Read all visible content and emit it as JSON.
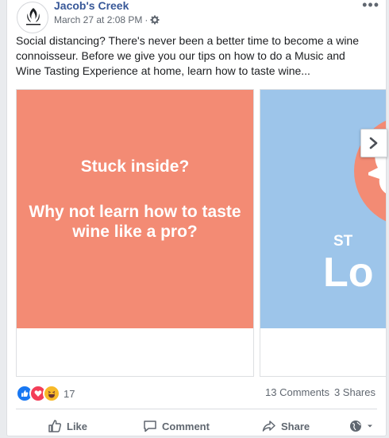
{
  "post": {
    "page_name": "Jacob's Creek",
    "timestamp": "March 27 at 2:08 PM",
    "separator": "·",
    "text": "Social distancing? There's never been a better time to become a wine connoisseur. Before we give you our tips on how to do a Music and Wine Tasting Experience at home, learn how to taste wine..."
  },
  "carousel": {
    "slide1": {
      "line1": "Stuck inside?",
      "line2": "Why not learn how to taste wine like a pro?"
    },
    "slide2": {
      "fragment_small": "ST",
      "fragment_large": "Lo"
    }
  },
  "engagement": {
    "reaction_count": "17",
    "comments": "13 Comments",
    "shares": "3 Shares"
  },
  "actions": {
    "like": "Like",
    "comment": "Comment",
    "share": "Share"
  },
  "colors": {
    "slide1_bg": "#f38b74",
    "slide2_bg": "#9dc5ea",
    "link": "#385898"
  }
}
